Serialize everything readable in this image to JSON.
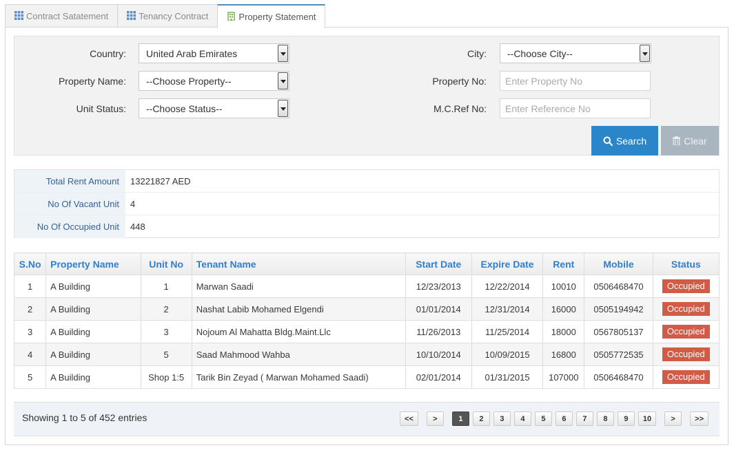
{
  "tabs": [
    {
      "label": "Contract Satatement",
      "icon": "grid-icon",
      "active": false
    },
    {
      "label": "Tenancy Contract",
      "icon": "grid-icon",
      "active": false
    },
    {
      "label": "Property Statement",
      "icon": "building-icon",
      "active": true
    }
  ],
  "search": {
    "country_label": "Country:",
    "country_value": "United Arab Emirates",
    "property_name_label": "Property Name:",
    "property_name_value": "--Choose Property--",
    "unit_status_label": "Unit Status:",
    "unit_status_value": "--Choose Status--",
    "city_label": "City:",
    "city_value": "--Choose City--",
    "property_no_label": "Property No:",
    "property_no_placeholder": "Enter Property No",
    "mcref_label": "M.C.Ref No:",
    "mcref_placeholder": "Enter Reference No",
    "search_button": "Search",
    "clear_button": "Clear"
  },
  "summary": [
    {
      "key": "Total Rent Amount",
      "value": "13221827 AED"
    },
    {
      "key": "No Of Vacant Unit",
      "value": "4"
    },
    {
      "key": "No Of Occupied Unit",
      "value": "448"
    }
  ],
  "table": {
    "headers": [
      "S.No",
      "Property Name",
      "Unit No",
      "Tenant Name",
      "Start Date",
      "Expire Date",
      "Rent",
      "Mobile",
      "Status"
    ],
    "rows": [
      {
        "sno": "1",
        "property": "A Building",
        "unit": "1",
        "tenant": "Marwan Saadi",
        "start": "12/23/2013",
        "expire": "12/22/2014",
        "rent": "10010",
        "mobile": "0506468470",
        "status": "Occupied"
      },
      {
        "sno": "2",
        "property": "A Building",
        "unit": "2",
        "tenant": "Nashat Labib Mohamed Elgendi",
        "start": "01/01/2014",
        "expire": "12/31/2014",
        "rent": "16000",
        "mobile": "0505194942",
        "status": "Occupied"
      },
      {
        "sno": "3",
        "property": "A Building",
        "unit": "3",
        "tenant": "Nojoum Al Mahatta Bldg.Maint.Llc",
        "start": "11/26/2013",
        "expire": "11/25/2014",
        "rent": "18000",
        "mobile": "0567805137",
        "status": "Occupied"
      },
      {
        "sno": "4",
        "property": "A Building",
        "unit": "5",
        "tenant": "Saad Mahmood Wahba",
        "start": "10/10/2014",
        "expire": "10/09/2015",
        "rent": "16800",
        "mobile": "0505772535",
        "status": "Occupied"
      },
      {
        "sno": "5",
        "property": "A Building",
        "unit": "Shop 1:5",
        "tenant": "Tarik Bin Zeyad ( Marwan Mohamed Saadi)",
        "start": "02/01/2014",
        "expire": "01/31/2015",
        "rent": "107000",
        "mobile": "0506468470",
        "status": "Occupied"
      }
    ]
  },
  "footer": {
    "info": "Showing 1 to 5 of 452 entries",
    "pager": {
      "first": "<<",
      "prev": ">",
      "pages": [
        "1",
        "2",
        "3",
        "4",
        "5",
        "6",
        "7",
        "8",
        "9",
        "10"
      ],
      "current": "1",
      "next": ">",
      "last": ">>"
    }
  },
  "colors": {
    "accent": "#2a86c8",
    "header_text": "#307ecc",
    "status_occupied": "#d15b47",
    "clear_button": "#a9b5bf"
  }
}
